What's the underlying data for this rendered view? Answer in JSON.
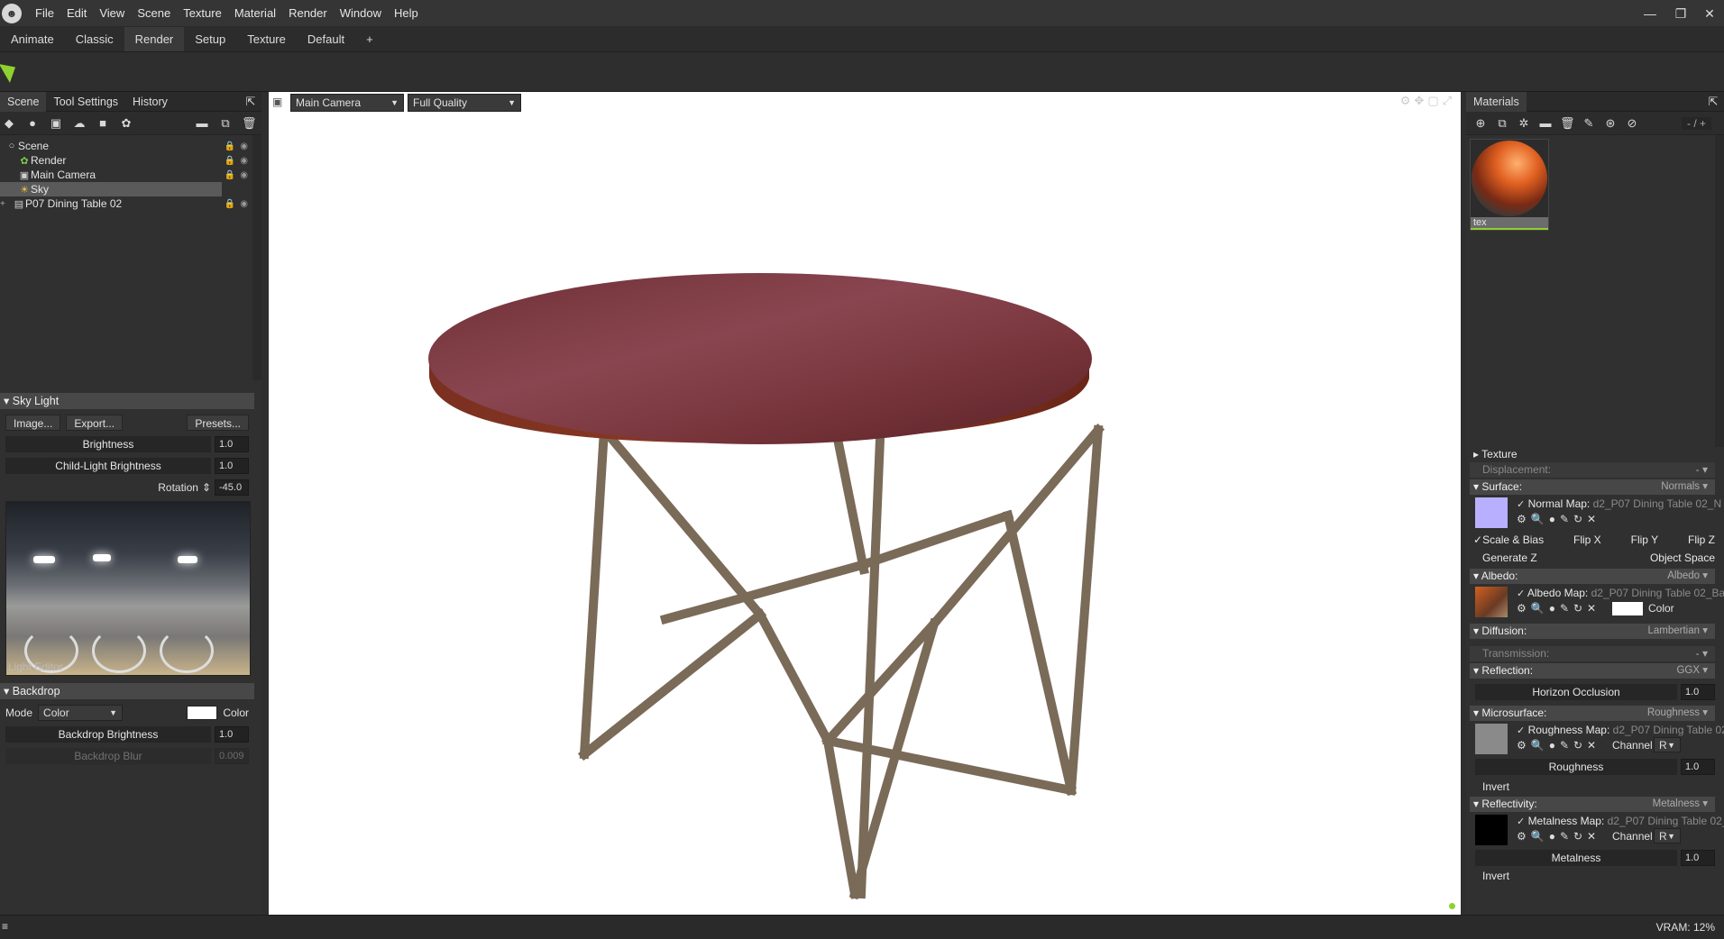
{
  "menu": [
    "File",
    "Edit",
    "View",
    "Scene",
    "Texture",
    "Material",
    "Render",
    "Window",
    "Help"
  ],
  "window_controls": {
    "minimize": "—",
    "maximize": "❐",
    "close": "✕"
  },
  "workspace_tabs": [
    "Animate",
    "Classic",
    "Render",
    "Setup",
    "Texture",
    "Default",
    "+"
  ],
  "scene_panel": {
    "tabs": [
      "Scene",
      "Tool Settings",
      "History"
    ],
    "tree": [
      {
        "label": "Scene",
        "icon": "○",
        "indent": 0,
        "selected": false
      },
      {
        "label": "Render",
        "icon": "✿",
        "indent": 1,
        "selected": false
      },
      {
        "label": "Main Camera",
        "icon": "▣",
        "indent": 1,
        "selected": false
      },
      {
        "label": "Sky",
        "icon": "☀",
        "indent": 1,
        "selected": true
      },
      {
        "label": "P07 Dining Table 02",
        "icon": "▤",
        "indent": 1,
        "selected": false
      }
    ]
  },
  "sky_light": {
    "header": "Sky Light",
    "buttons": {
      "image": "Image...",
      "export": "Export...",
      "presets": "Presets..."
    },
    "brightness_label": "Brightness",
    "brightness_value": "1.0",
    "child_brightness_label": "Child-Light Brightness",
    "child_brightness_value": "1.0",
    "rotation_label": "Rotation",
    "rotation_value": "-45.0",
    "preview_caption": "Light Editor"
  },
  "backdrop": {
    "header": "Backdrop",
    "mode_label": "Mode",
    "mode_value": "Color",
    "color_label": "Color",
    "brightness_label": "Backdrop Brightness",
    "brightness_value": "1.0",
    "blur_label": "Backdrop Blur",
    "blur_value": "0.009"
  },
  "viewport": {
    "camera": "Main Camera",
    "quality": "Full Quality"
  },
  "materials": {
    "header": "Materials",
    "counter": "- / +",
    "material_name": "tex",
    "sections": {
      "texture": "Texture",
      "displacement": "Displacement:",
      "displacement_value": "-",
      "surface": "Surface:",
      "surface_value": "Normals",
      "normal_map": "Normal Map:",
      "normal_file": "d2_P07 Dining Table 02_N",
      "scale_bias": "Scale & Bias",
      "flip_x": "Flip X",
      "flip_y": "Flip Y",
      "flip_z": "Flip Z",
      "generate_z": "Generate Z",
      "object_space": "Object Space",
      "albedo": "Albedo:",
      "albedo_value": "Albedo",
      "albedo_map": "Albedo Map:",
      "albedo_file": "d2_P07 Dining Table 02_Ba",
      "albedo_color": "Color",
      "diffusion": "Diffusion:",
      "diffusion_value": "Lambertian",
      "transmission": "Transmission:",
      "transmission_value": "-",
      "reflection": "Reflection:",
      "reflection_value": "GGX",
      "horizon": "Horizon Occlusion",
      "horizon_value": "1.0",
      "microsurface": "Microsurface:",
      "microsurface_value": "Roughness",
      "roughness_map": "Roughness Map:",
      "roughness_file": "d2_P07 Dining Table 02",
      "channel": "Channel",
      "channel_value": "R",
      "roughness": "Roughness",
      "roughness_value": "1.0",
      "invert": "Invert",
      "reflectivity": "Reflectivity:",
      "reflectivity_value": "Metalness",
      "metalness_map": "Metalness Map:",
      "metalness_file": "d2_P07 Dining Table 02_",
      "metalness": "Metalness",
      "metalness_value": "1.0"
    }
  },
  "status": {
    "vram": "VRAM: 12%"
  }
}
